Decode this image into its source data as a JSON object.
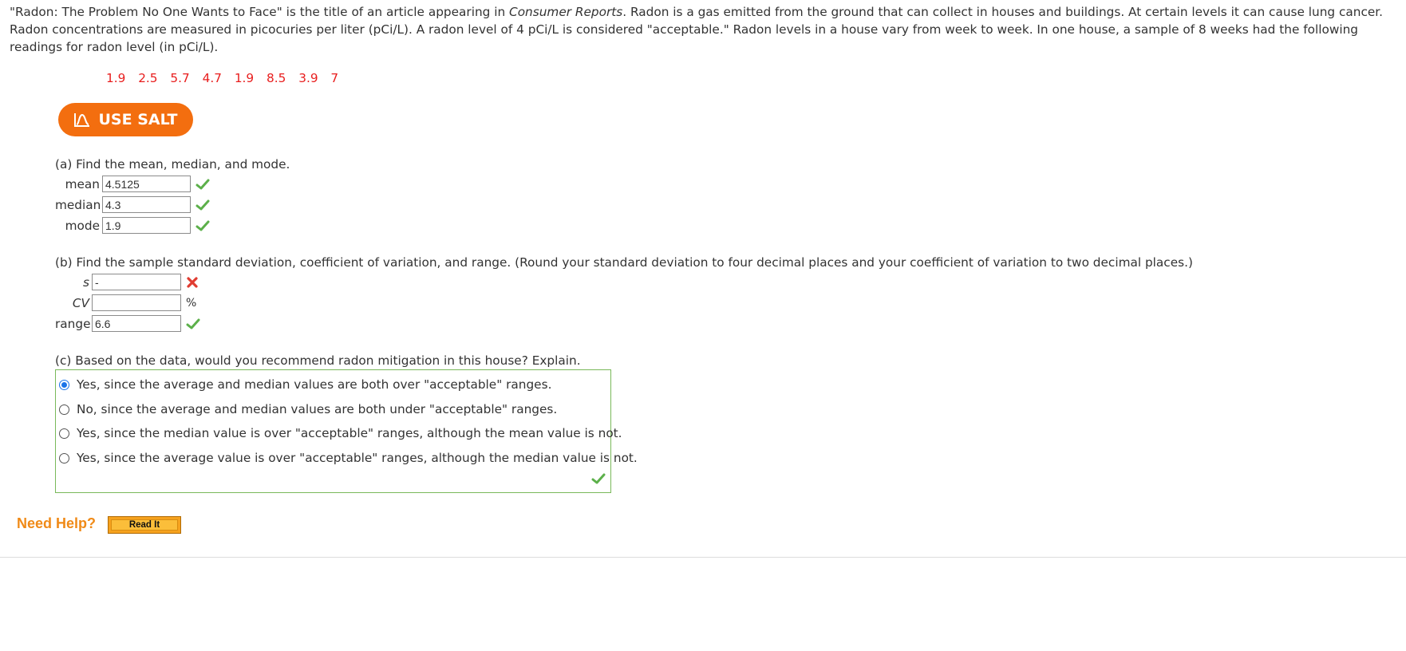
{
  "intro": {
    "part1": "\"Radon: The Problem No One Wants to Face\" is the title of an article appearing in ",
    "source": "Consumer Reports",
    "part2": ". Radon is a gas emitted from the ground that can collect in houses and buildings. At certain levels it can cause lung cancer. Radon concentrations are measured in picocuries per liter (pCi/L). A radon level of 4 pCi/L is considered \"acceptable.\" Radon levels in a house vary from week to week. In one house, a sample of 8 weeks had the following readings for radon level (in pCi/L)."
  },
  "readings": [
    "1.9",
    "2.5",
    "5.7",
    "4.7",
    "1.9",
    "8.5",
    "3.9",
    "7"
  ],
  "salt_button": {
    "label": "USE SALT",
    "icon": "distribution-curve-icon"
  },
  "part_a": {
    "question": "(a) Find the mean, median, and mode.",
    "fields": [
      {
        "label": "mean",
        "value": "4.5125",
        "status": "correct"
      },
      {
        "label": "median",
        "value": "4.3",
        "status": "correct"
      },
      {
        "label": "mode",
        "value": "1.9",
        "status": "correct"
      }
    ]
  },
  "part_b": {
    "question": "(b) Find the sample standard deviation, coefficient of variation, and range. (Round your standard deviation to four decimal places and your coefficient of variation to two decimal places.)",
    "fields": [
      {
        "label": "s",
        "value": "-",
        "status": "incorrect"
      },
      {
        "label": "CV",
        "value": "",
        "unit": "%"
      },
      {
        "label": "range",
        "value": "6.6",
        "status": "correct"
      }
    ]
  },
  "part_c": {
    "question": "(c) Based on the data, would you recommend radon mitigation in this house? Explain.",
    "options": [
      "Yes, since the average and median values are both over \"acceptable\" ranges.",
      "No, since the average and median values are both under \"acceptable\" ranges.",
      "Yes, since the median value is over \"acceptable\" ranges, although the mean value is not.",
      "Yes, since the average value is over \"acceptable\" ranges, although the median value is not."
    ],
    "selected_index": 0,
    "status": "correct"
  },
  "help": {
    "label": "Need Help?",
    "button": "Read It"
  },
  "colors": {
    "readings": "#e81d1d",
    "salt_button": "#f36e0f",
    "correct": "#5cb04a",
    "incorrect": "#e03c31",
    "choices_border": "#79b95a",
    "need_help": "#f08a17",
    "radio_selected": "#1a73e8"
  }
}
